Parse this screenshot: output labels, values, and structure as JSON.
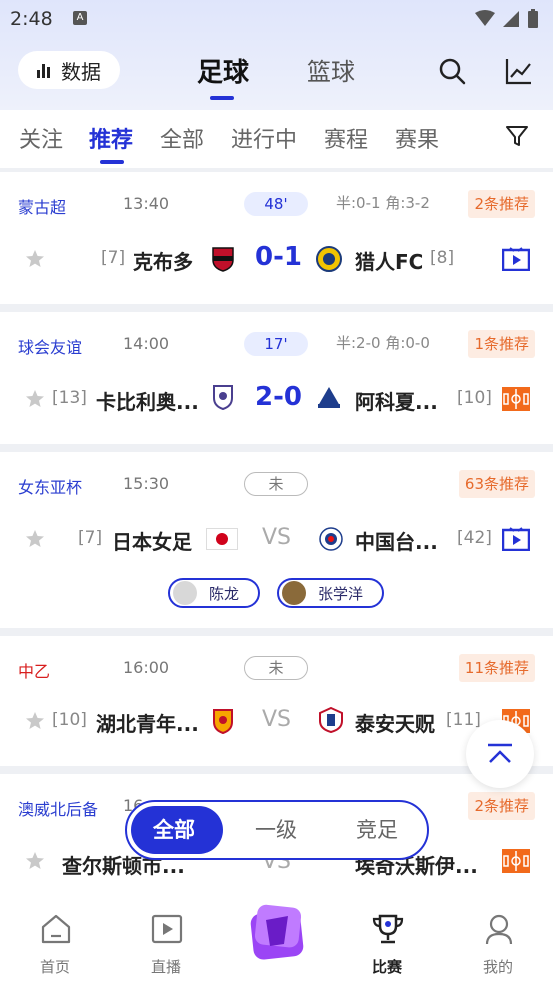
{
  "status_bar": {
    "time": "2:48",
    "app_badge": "A"
  },
  "header": {
    "data_button": "数据",
    "tabs": [
      {
        "label": "足球",
        "active": true
      },
      {
        "label": "篮球",
        "active": false
      }
    ],
    "search_icon": "search-icon",
    "chart_icon": "trend-chart-icon"
  },
  "sub_tabs": [
    {
      "label": "关注"
    },
    {
      "label": "推荐",
      "active": true
    },
    {
      "label": "全部"
    },
    {
      "label": "进行中"
    },
    {
      "label": "赛程"
    },
    {
      "label": "赛果"
    }
  ],
  "matches": [
    {
      "league": "蒙古超",
      "time": "13:40",
      "status": "48'",
      "half": "半:0-1 角:3-2",
      "rec": "2条推荐",
      "home_rank": "[7]",
      "home": "克布多",
      "score": "0-1",
      "away": "猎人FC",
      "away_rank": "[8]",
      "media": "tv"
    },
    {
      "league": "球会友谊",
      "time": "14:00",
      "status": "17'",
      "half": "半:2-0 角:0-0",
      "rec": "1条推荐",
      "home_rank": "[13]",
      "home": "卡比利奥...",
      "score": "2-0",
      "away": "阿科夏...",
      "away_rank": "[10]",
      "media": "pitch"
    },
    {
      "league": "女东亚杯",
      "time": "15:30",
      "status": "未",
      "half": "",
      "rec": "63条推荐",
      "home_rank": "[7]",
      "home": "日本女足",
      "score": "VS",
      "away": "中国台...",
      "away_rank": "[42]",
      "media": "tv",
      "experts": [
        "陈龙",
        "张学洋"
      ]
    },
    {
      "league": "中乙",
      "time": "16:00",
      "status": "未",
      "half": "",
      "rec": "11条推荐",
      "home_rank": "[10]",
      "home": "湖北青年...",
      "score": "VS",
      "away": "泰安天贶",
      "away_rank": "[11]",
      "media": "pitch"
    },
    {
      "league": "澳威北后备",
      "time": "16",
      "status": "",
      "half": "",
      "rec": "2条推荐",
      "home_rank": "",
      "home": "查尔斯顿市...",
      "score": "VS",
      "away": "埃奇沃斯伊...",
      "away_rank": "",
      "media": "pitch"
    }
  ],
  "segment": {
    "options": [
      "全部",
      "一级",
      "竞足"
    ],
    "selected": "全部"
  },
  "tabbar": [
    {
      "label": "首页",
      "icon": "home-icon"
    },
    {
      "label": "直播",
      "icon": "play-icon"
    },
    {
      "label": "",
      "icon": "promo-badge-icon"
    },
    {
      "label": "比赛",
      "icon": "trophy-icon",
      "active": true
    },
    {
      "label": "我的",
      "icon": "profile-icon"
    }
  ],
  "colors": {
    "accent": "#2432d6",
    "orange": "#e66a2c",
    "league_blue": "#2b3ed0",
    "league_red": "#d81e1e"
  }
}
